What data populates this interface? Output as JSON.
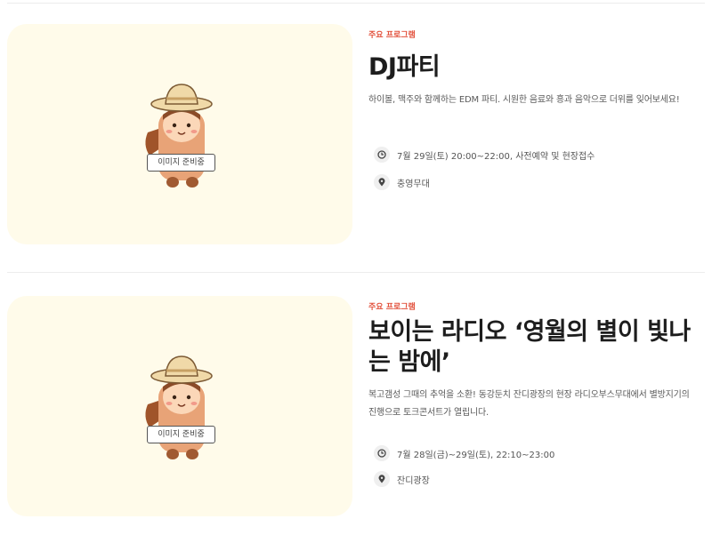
{
  "events": [
    {
      "category": "주요 프로그램",
      "title": "DJ파티",
      "description": "하이볼, 맥주와 함께하는 EDM 파티. 시원한 음료와 흥과 음악으로 더위를 잊어보세요!",
      "schedule": "7월 29일(토) 20:00~22:00, 사전예약 및 현장접수",
      "place": "충영무대",
      "image_label": "이미지 준비중"
    },
    {
      "category": "주요 프로그램",
      "title": "보이는 라디오 ‘영월의 별이 빛나는 밤에’",
      "description": "복고갬성 그때의 추억을 소환! 동강둔치 잔디광장의 현장 라디오부스무대에서 별방지기의 진행으로 토크콘서트가 열립니다.",
      "schedule": "7월 28일(금)~29일(토), 22:10~23:00",
      "place": "잔디광장",
      "image_label": "이미지 준비중"
    }
  ],
  "colors": {
    "category": "#e2503b",
    "thumb_bg": "#fffbea",
    "mascot_skin": "#f2b28a",
    "mascot_hat": "#f0d9a8"
  },
  "icons": {
    "schedule": "clock-icon",
    "place": "map-pin-icon"
  }
}
